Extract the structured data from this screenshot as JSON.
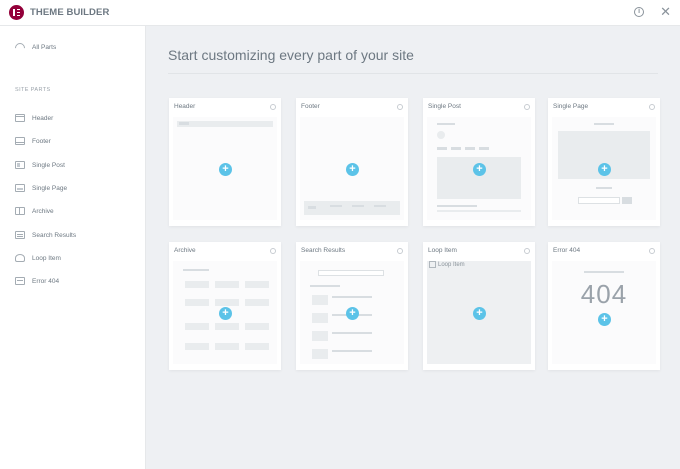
{
  "app": {
    "title": "THEME BUILDER"
  },
  "topbar_icons": {
    "info": "info-icon",
    "close": "close-icon"
  },
  "sidebar": {
    "all_parts": "All Parts",
    "section_heading": "SITE PARTS",
    "items": [
      {
        "label": "Header",
        "icon": "header-icon"
      },
      {
        "label": "Footer",
        "icon": "footer-icon"
      },
      {
        "label": "Single Post",
        "icon": "single-post-icon"
      },
      {
        "label": "Single Page",
        "icon": "single-page-icon"
      },
      {
        "label": "Archive",
        "icon": "archive-icon"
      },
      {
        "label": "Search Results",
        "icon": "search-results-icon"
      },
      {
        "label": "Loop Item",
        "icon": "loop-item-icon"
      },
      {
        "label": "Error 404",
        "icon": "error-404-icon"
      }
    ]
  },
  "main": {
    "title": "Start customizing every part of your site",
    "cards": [
      {
        "label": "Header"
      },
      {
        "label": "Footer"
      },
      {
        "label": "Single Post"
      },
      {
        "label": "Single Page"
      },
      {
        "label": "Archive"
      },
      {
        "label": "Search Results"
      },
      {
        "label": "Loop Item",
        "image_alt": "Loop Item"
      },
      {
        "label": "Error 404",
        "big_text": "404"
      }
    ]
  },
  "colors": {
    "accent": "#5cc3e8",
    "brand": "#93003a",
    "background": "#eef0f3"
  }
}
